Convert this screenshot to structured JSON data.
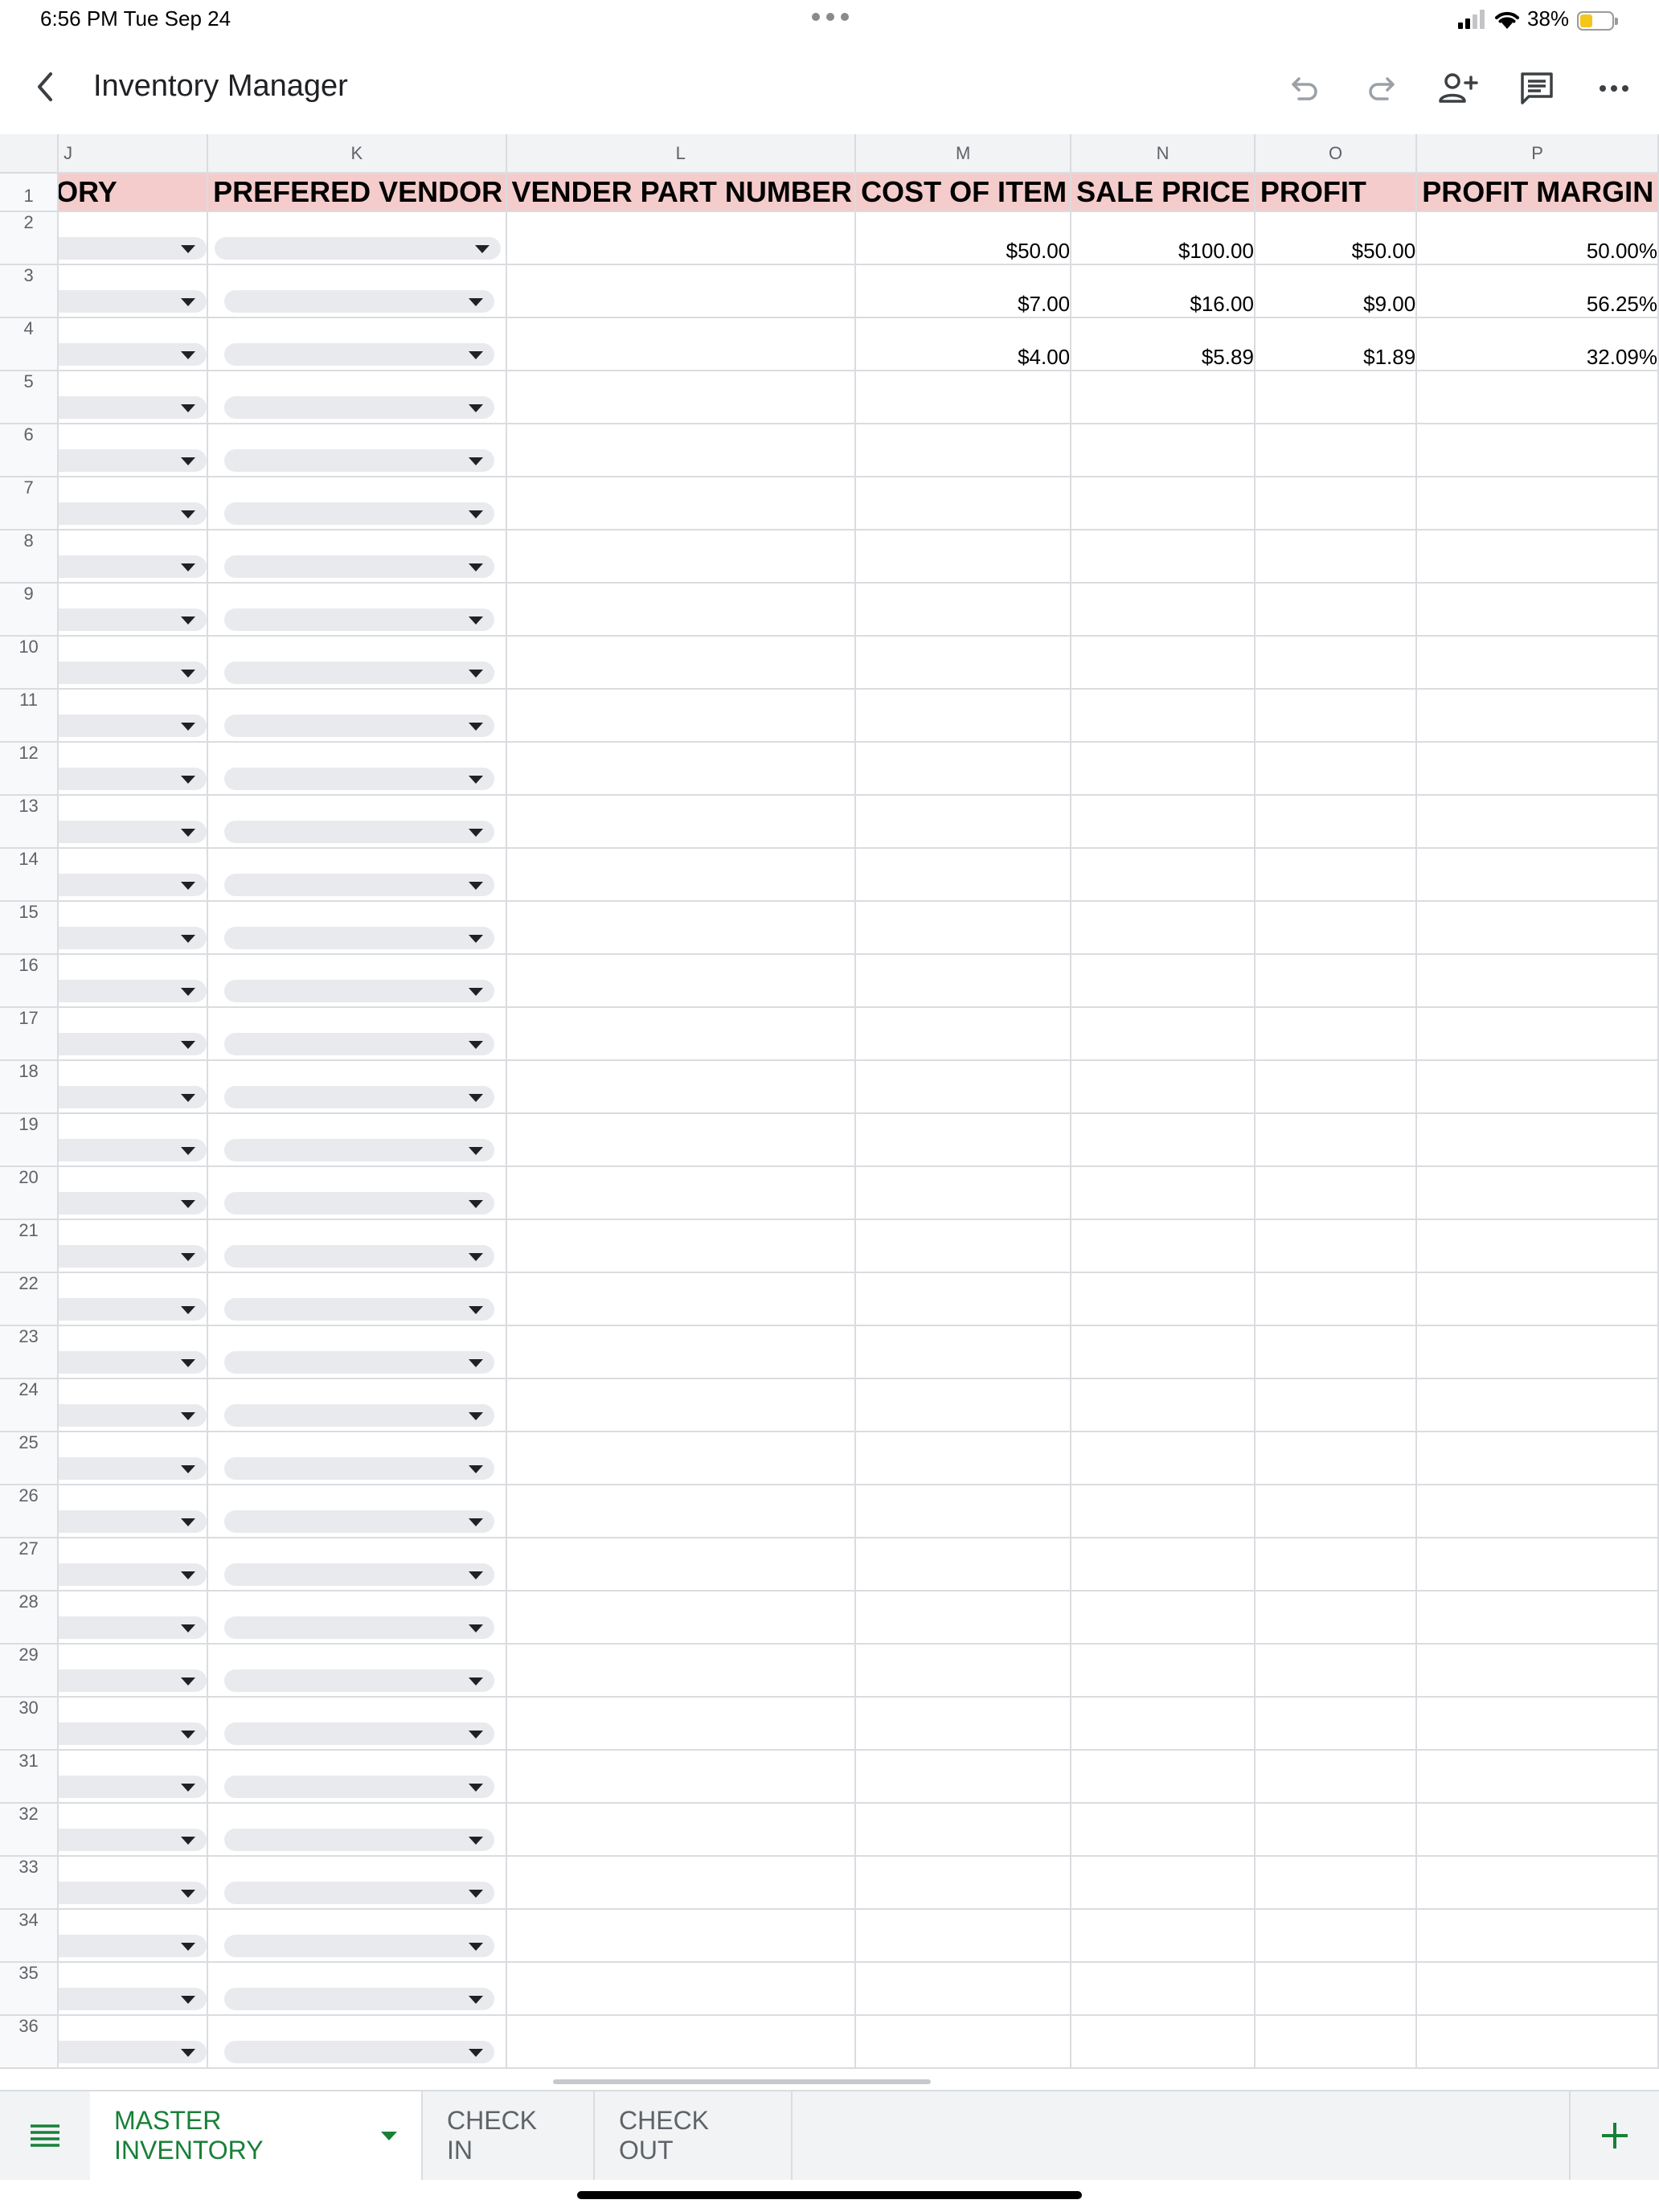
{
  "status": {
    "time": "6:56 PM   Tue Sep 24",
    "battery": "38%"
  },
  "app": {
    "title": "Inventory Manager"
  },
  "toolbar": {
    "icons": [
      "back-icon",
      "undo-icon",
      "redo-icon",
      "add-person-icon",
      "comment-icon",
      "more-icon"
    ]
  },
  "sheet": {
    "columns": [
      "J",
      "K",
      "L",
      "M",
      "N",
      "O",
      "P"
    ],
    "headers": {
      "J": "GORY",
      "K": "PREFERED VENDOR",
      "L": "VENDER PART NUMBER",
      "M": "COST OF ITEM",
      "N": "SALE PRICE",
      "O": "PROFIT",
      "P": "PROFIT MARGIN"
    },
    "header_color": "#f4cccc",
    "rows": [
      {
        "num": "2",
        "cost": "$50.00",
        "sale": "$100.00",
        "profit": "$50.00",
        "margin": "50.00%"
      },
      {
        "num": "3",
        "cost": "$7.00",
        "sale": "$16.00",
        "profit": "$9.00",
        "margin": "56.25%"
      },
      {
        "num": "4",
        "cost": "$4.00",
        "sale": "$5.89",
        "profit": "$1.89",
        "margin": "32.09%"
      },
      {
        "num": "5",
        "cost": "",
        "sale": "",
        "profit": "",
        "margin": ""
      },
      {
        "num": "6",
        "cost": "",
        "sale": "",
        "profit": "",
        "margin": ""
      },
      {
        "num": "7",
        "cost": "",
        "sale": "",
        "profit": "",
        "margin": ""
      },
      {
        "num": "8",
        "cost": "",
        "sale": "",
        "profit": "",
        "margin": ""
      },
      {
        "num": "9",
        "cost": "",
        "sale": "",
        "profit": "",
        "margin": ""
      },
      {
        "num": "10",
        "cost": "",
        "sale": "",
        "profit": "",
        "margin": ""
      },
      {
        "num": "11",
        "cost": "",
        "sale": "",
        "profit": "",
        "margin": ""
      },
      {
        "num": "12",
        "cost": "",
        "sale": "",
        "profit": "",
        "margin": ""
      },
      {
        "num": "13",
        "cost": "",
        "sale": "",
        "profit": "",
        "margin": ""
      },
      {
        "num": "14",
        "cost": "",
        "sale": "",
        "profit": "",
        "margin": ""
      },
      {
        "num": "15",
        "cost": "",
        "sale": "",
        "profit": "",
        "margin": ""
      },
      {
        "num": "16",
        "cost": "",
        "sale": "",
        "profit": "",
        "margin": ""
      },
      {
        "num": "17",
        "cost": "",
        "sale": "",
        "profit": "",
        "margin": ""
      },
      {
        "num": "18",
        "cost": "",
        "sale": "",
        "profit": "",
        "margin": ""
      },
      {
        "num": "19",
        "cost": "",
        "sale": "",
        "profit": "",
        "margin": ""
      },
      {
        "num": "20",
        "cost": "",
        "sale": "",
        "profit": "",
        "margin": ""
      },
      {
        "num": "21",
        "cost": "",
        "sale": "",
        "profit": "",
        "margin": ""
      },
      {
        "num": "22",
        "cost": "",
        "sale": "",
        "profit": "",
        "margin": ""
      },
      {
        "num": "23",
        "cost": "",
        "sale": "",
        "profit": "",
        "margin": ""
      },
      {
        "num": "24",
        "cost": "",
        "sale": "",
        "profit": "",
        "margin": ""
      },
      {
        "num": "25",
        "cost": "",
        "sale": "",
        "profit": "",
        "margin": ""
      },
      {
        "num": "26",
        "cost": "",
        "sale": "",
        "profit": "",
        "margin": ""
      },
      {
        "num": "27",
        "cost": "",
        "sale": "",
        "profit": "",
        "margin": ""
      },
      {
        "num": "28",
        "cost": "",
        "sale": "",
        "profit": "",
        "margin": ""
      },
      {
        "num": "29",
        "cost": "",
        "sale": "",
        "profit": "",
        "margin": ""
      },
      {
        "num": "30",
        "cost": "",
        "sale": "",
        "profit": "",
        "margin": ""
      },
      {
        "num": "31",
        "cost": "",
        "sale": "",
        "profit": "",
        "margin": ""
      },
      {
        "num": "32",
        "cost": "",
        "sale": "",
        "profit": "",
        "margin": ""
      },
      {
        "num": "33",
        "cost": "",
        "sale": "",
        "profit": "",
        "margin": ""
      },
      {
        "num": "34",
        "cost": "",
        "sale": "",
        "profit": "",
        "margin": ""
      },
      {
        "num": "35",
        "cost": "",
        "sale": "",
        "profit": "",
        "margin": ""
      },
      {
        "num": "36",
        "cost": "",
        "sale": "",
        "profit": "",
        "margin": ""
      }
    ]
  },
  "tabs": [
    {
      "label": "MASTER INVENTORY",
      "active": true
    },
    {
      "label": "CHECK IN",
      "active": false
    },
    {
      "label": "CHECK OUT",
      "active": false
    }
  ],
  "colors": {
    "accent": "#188038",
    "header_fill": "#f4cccc"
  }
}
